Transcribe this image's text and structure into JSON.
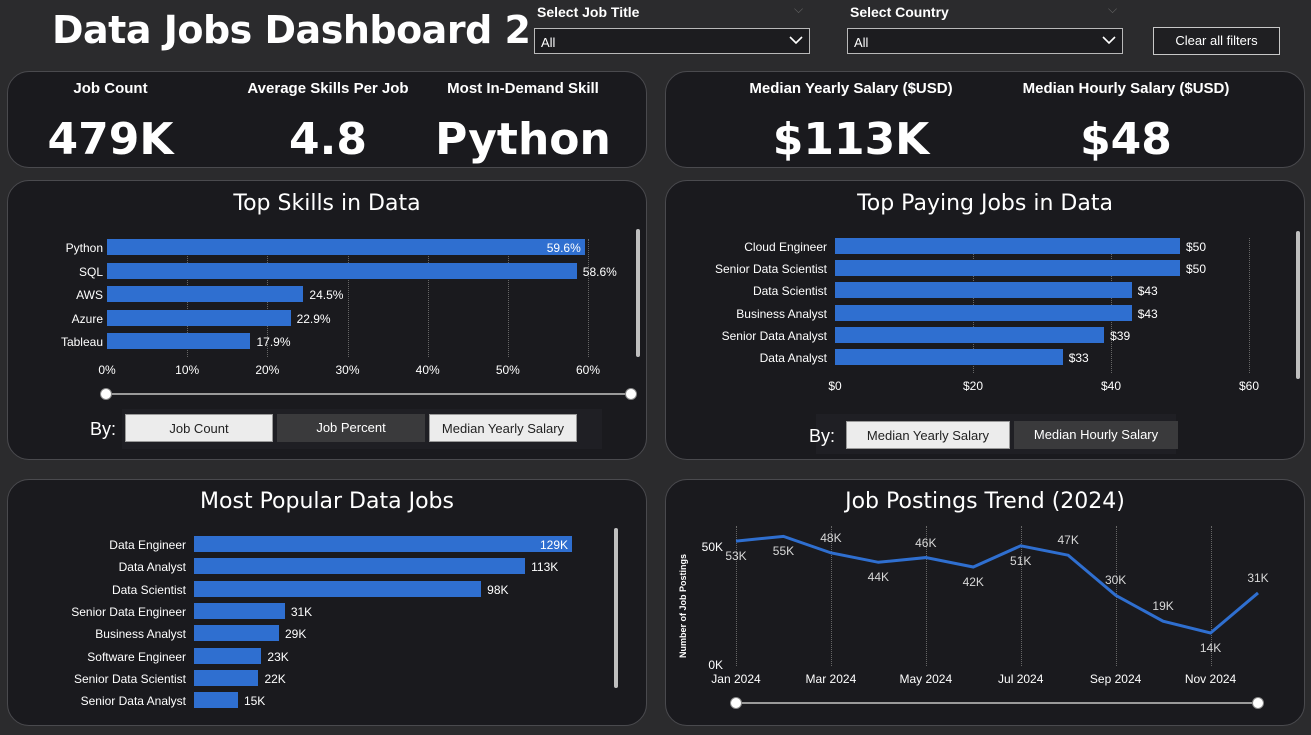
{
  "header": {
    "title": "Data Jobs Dashboard 2",
    "job_title_filter": {
      "label": "Select Job Title",
      "value": "All"
    },
    "country_filter": {
      "label": "Select Country",
      "value": "All"
    },
    "clear_button": "Clear all filters"
  },
  "kpis_left": {
    "job_count": {
      "label": "Job Count",
      "value": "479K"
    },
    "avg_skills": {
      "label": "Average Skills Per Job",
      "value": "4.8"
    },
    "top_skill": {
      "label": "Most In-Demand Skill",
      "value": "Python"
    }
  },
  "kpis_right": {
    "median_yearly": {
      "label": "Median Yearly Salary ($USD)",
      "value": "$113K"
    },
    "median_hourly": {
      "label": "Median Hourly Salary ($USD)",
      "value": "$48"
    }
  },
  "top_skills": {
    "title": "Top Skills in Data",
    "by_label": "By:",
    "buttons": [
      "Job Count",
      "Job Percent",
      "Median Yearly Salary"
    ],
    "active_button": "Job Count"
  },
  "top_paying": {
    "title": "Top Paying Jobs in Data",
    "by_label": "By:",
    "buttons": [
      "Median Yearly Salary",
      "Median Hourly Salary"
    ],
    "active_button": "Median Yearly Salary"
  },
  "popular_jobs": {
    "title": "Most Popular Data Jobs"
  },
  "postings_trend": {
    "title": "Job Postings Trend (2024)"
  },
  "chart_data": [
    {
      "id": "skills",
      "type": "bar",
      "orientation": "horizontal",
      "title": "Top Skills in Data",
      "categories": [
        "Python",
        "SQL",
        "AWS",
        "Azure",
        "Tableau"
      ],
      "values": [
        59.6,
        58.6,
        24.5,
        22.9,
        17.9
      ],
      "value_labels": [
        "59.6%",
        "58.6%",
        "24.5%",
        "22.9%",
        "17.9%"
      ],
      "x_ticks": [
        "0%",
        "10%",
        "20%",
        "30%",
        "40%",
        "50%",
        "60%"
      ],
      "xlim": [
        0,
        60
      ],
      "grid": true,
      "color": "#2f6fd0"
    },
    {
      "id": "paying",
      "type": "bar",
      "orientation": "horizontal",
      "title": "Top Paying Jobs in Data",
      "categories": [
        "Cloud Engineer",
        "Senior Data Scientist",
        "Data Scientist",
        "Business Analyst",
        "Senior Data Analyst",
        "Data Analyst"
      ],
      "values": [
        50,
        50,
        43,
        43,
        39,
        33
      ],
      "value_labels": [
        "$50",
        "$50",
        "$43",
        "$43",
        "$39",
        "$33"
      ],
      "x_ticks": [
        "$0",
        "$20",
        "$40",
        "$60"
      ],
      "xlim": [
        0,
        60
      ],
      "grid": true,
      "color": "#2f6fd0"
    },
    {
      "id": "popular",
      "type": "bar",
      "orientation": "horizontal",
      "title": "Most Popular Data Jobs",
      "categories": [
        "Data Engineer",
        "Data Analyst",
        "Data Scientist",
        "Senior Data Engineer",
        "Business Analyst",
        "Software Engineer",
        "Senior Data Scientist",
        "Senior Data Analyst"
      ],
      "values": [
        129,
        113,
        98,
        31,
        29,
        23,
        22,
        15
      ],
      "value_labels": [
        "129K",
        "113K",
        "98K",
        "31K",
        "29K",
        "23K",
        "22K",
        "15K"
      ],
      "xlim": [
        0,
        129
      ],
      "color": "#2f6fd0"
    },
    {
      "id": "trend",
      "type": "line",
      "title": "Job Postings Trend (2024)",
      "ylabel": "Number of Job Postings",
      "x": [
        "Jan 2024",
        "Feb 2024",
        "Mar 2024",
        "Apr 2024",
        "May 2024",
        "Jun 2024",
        "Jul 2024",
        "Aug 2024",
        "Sep 2024",
        "Oct 2024",
        "Nov 2024",
        "Dec 2024"
      ],
      "values": [
        53,
        55,
        48,
        44,
        46,
        42,
        51,
        47,
        30,
        19,
        14,
        31
      ],
      "value_labels": [
        "53K",
        "55K",
        "48K",
        "44K",
        "46K",
        "42K",
        "51K",
        "47K",
        "30K",
        "19K",
        "14K",
        "31K"
      ],
      "x_ticks": [
        "Jan 2024",
        "Mar 2024",
        "May 2024",
        "Jul 2024",
        "Sep 2024",
        "Nov 2024"
      ],
      "y_ticks": [
        "0K",
        "50K"
      ],
      "ylim": [
        0,
        56
      ],
      "grid": true,
      "color": "#2f6fd0"
    }
  ]
}
